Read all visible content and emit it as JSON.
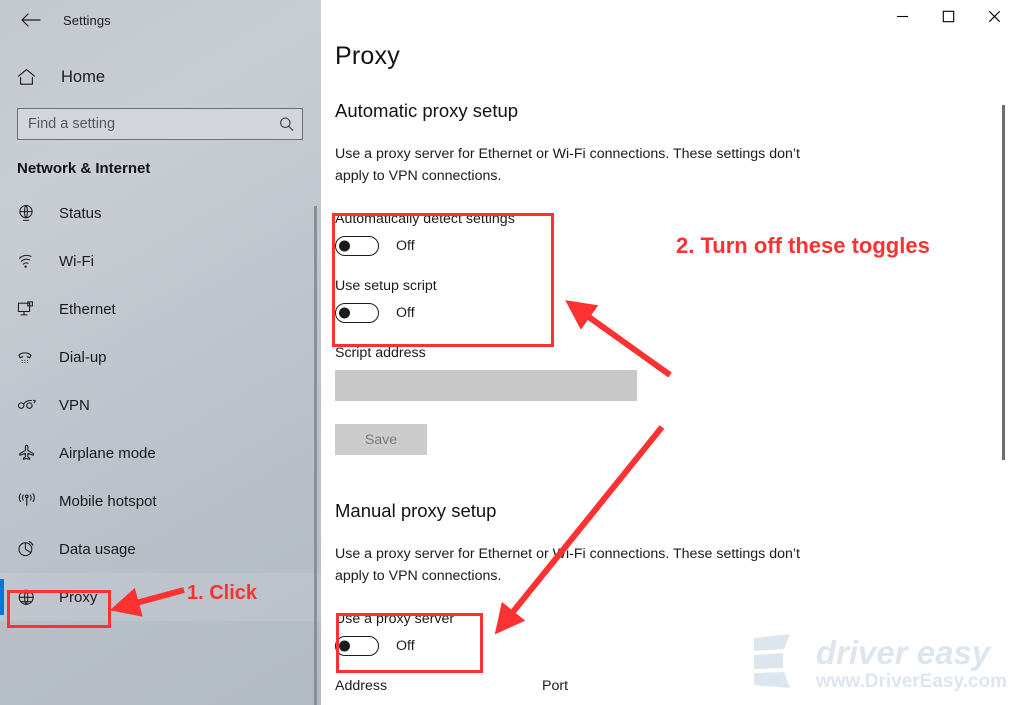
{
  "window": {
    "title": "Settings",
    "back_icon": "back-arrow-icon",
    "controls": [
      {
        "name": "minimize",
        "glyph": "─"
      },
      {
        "name": "maximize",
        "glyph": "☐"
      },
      {
        "name": "close",
        "glyph": "✕"
      }
    ]
  },
  "sidebar": {
    "home_label": "Home",
    "home_icon": "home-icon",
    "search": {
      "placeholder": "Find a setting",
      "value": "",
      "icon": "search-icon"
    },
    "category": "Network & Internet",
    "items": [
      {
        "label": "Status",
        "icon": "status-globe-icon",
        "selected": false
      },
      {
        "label": "Wi-Fi",
        "icon": "wifi-icon",
        "selected": false
      },
      {
        "label": "Ethernet",
        "icon": "ethernet-icon",
        "selected": false
      },
      {
        "label": "Dial-up",
        "icon": "dialup-phone-icon",
        "selected": false
      },
      {
        "label": "VPN",
        "icon": "vpn-icon",
        "selected": false
      },
      {
        "label": "Airplane mode",
        "icon": "airplane-icon",
        "selected": false
      },
      {
        "label": "Mobile hotspot",
        "icon": "hotspot-icon",
        "selected": false
      },
      {
        "label": "Data usage",
        "icon": "data-usage-pie-icon",
        "selected": false
      },
      {
        "label": "Proxy",
        "icon": "proxy-globe-icon",
        "selected": true
      }
    ]
  },
  "main": {
    "page_title": "Proxy",
    "automatic": {
      "heading": "Automatic proxy setup",
      "description": "Use a proxy server for Ethernet or Wi-Fi connections. These settings don’t apply to VPN connections.",
      "auto_detect_label": "Automatically detect settings",
      "auto_detect_state": "Off",
      "setup_script_label": "Use setup script",
      "setup_script_state": "Off",
      "script_address_label": "Script address",
      "script_address_value": "",
      "save_label": "Save"
    },
    "manual": {
      "heading": "Manual proxy setup",
      "description": "Use a proxy server for Ethernet or Wi-Fi connections. These settings don’t apply to VPN connections.",
      "use_proxy_label": "Use a proxy server",
      "use_proxy_state": "Off",
      "address_label": "Address",
      "port_label": "Port"
    }
  },
  "annotations": {
    "color": "#fc3232",
    "step1": "1. Click",
    "step2": "2. Turn off these toggles"
  },
  "watermark": {
    "brand": "driver easy",
    "url": "www.DriverEasy.com",
    "color": "#dde6ef"
  },
  "colors": {
    "accent": "#0078d7",
    "annotation_red": "#fc3232",
    "sidebar_bg": "#c0c6cd",
    "disabled_field": "#c8c8c8",
    "disabled_button": "#cccccc"
  }
}
